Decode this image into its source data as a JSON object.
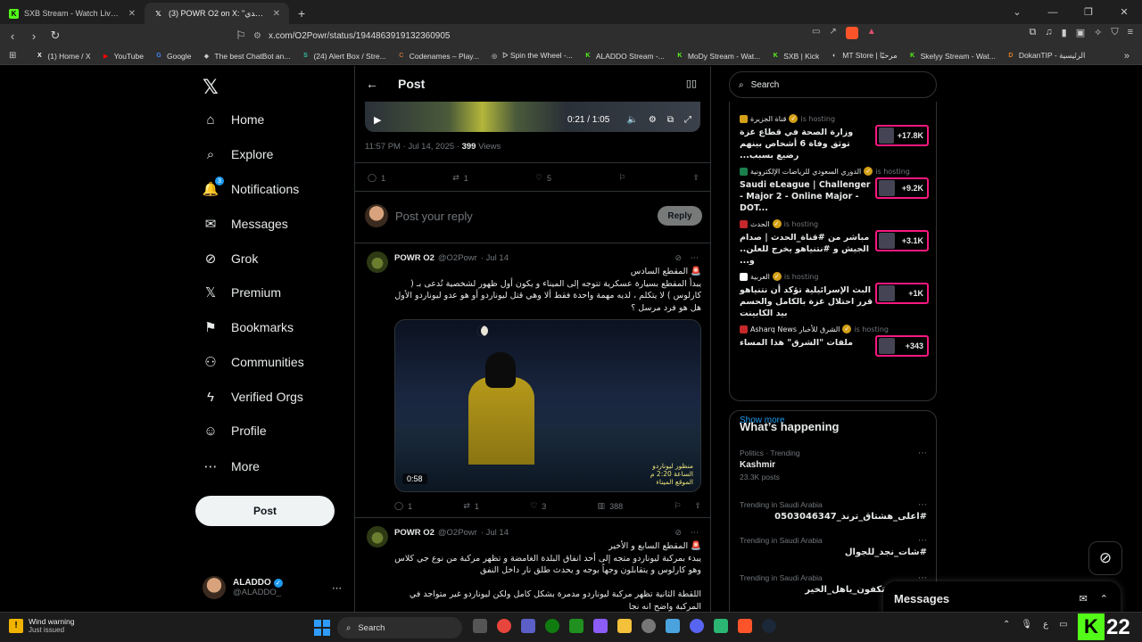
{
  "browser": {
    "tabs": [
      {
        "title": "SXB Stream - Watch Live on Kick",
        "icon": "kick-icon",
        "color": "#53fc18",
        "active": false
      },
      {
        "title": "(3) POWR O2 on X: \"لبوناردو كاسدي\"",
        "icon": "x-icon",
        "color": "#ffffff",
        "active": true
      }
    ],
    "new_tab": "+",
    "url": "x.com/O2Powr/status/1944863919132360905",
    "bookmarks": [
      {
        "label": "(1) Home / X",
        "color": "#ffffff",
        "glyph": "X"
      },
      {
        "label": "YouTube",
        "color": "#ff0000",
        "glyph": "▶"
      },
      {
        "label": "Google",
        "color": "#4285f4",
        "glyph": "G"
      },
      {
        "label": "The best ChatBot an...",
        "color": "#cccccc",
        "glyph": "◆"
      },
      {
        "label": "(24) Alert Box / Stre...",
        "color": "#31c3a2",
        "glyph": "S"
      },
      {
        "label": "Codenames – Play...",
        "color": "#c0703a",
        "glyph": "C"
      },
      {
        "label": "ᐅ Spin the Wheel -...",
        "color": "#e8e8e8",
        "glyph": "◎"
      },
      {
        "label": "ALADDO Stream -...",
        "color": "#53fc18",
        "glyph": "K"
      },
      {
        "label": "MoDy Stream - Wat...",
        "color": "#53fc18",
        "glyph": "K"
      },
      {
        "label": "SXB | Kick",
        "color": "#53fc18",
        "glyph": "K"
      },
      {
        "label": "MT Store | مرحبًا",
        "color": "#dddddd",
        "glyph": "◐"
      },
      {
        "label": "Skelyy Stream - Wat...",
        "color": "#53fc18",
        "glyph": "K"
      },
      {
        "label": "DokanTIP - الرئيسية",
        "color": "#d9822b",
        "glyph": "D"
      }
    ]
  },
  "nav": {
    "items": [
      {
        "label": "Home",
        "icon": "home-icon",
        "glyph": "⌂"
      },
      {
        "label": "Explore",
        "icon": "search-icon",
        "glyph": "⌕"
      },
      {
        "label": "Notifications",
        "icon": "bell-icon",
        "glyph": "🔔",
        "badge": "3"
      },
      {
        "label": "Messages",
        "icon": "mail-icon",
        "glyph": "✉"
      },
      {
        "label": "Grok",
        "icon": "grok-icon",
        "glyph": "⊘"
      },
      {
        "label": "Premium",
        "icon": "x-premium-icon",
        "glyph": "𝕏"
      },
      {
        "label": "Bookmarks",
        "icon": "bookmark-icon",
        "glyph": "⚑"
      },
      {
        "label": "Communities",
        "icon": "communities-icon",
        "glyph": "⚇"
      },
      {
        "label": "Verified Orgs",
        "icon": "lightning-icon",
        "glyph": "ϟ"
      },
      {
        "label": "Profile",
        "icon": "person-icon",
        "glyph": "☺"
      },
      {
        "label": "More",
        "icon": "more-circle-icon",
        "glyph": "⋯"
      }
    ],
    "post_label": "Post",
    "account": {
      "name": "ALADDO",
      "handle": "@ALADDO_"
    }
  },
  "main": {
    "title": "Post",
    "video_time": "0:21 / 1:05",
    "meta_time": "11:57 PM · Jul 14, 2025 · ",
    "meta_views_num": "399",
    "meta_views_label": " Views",
    "actions": {
      "replies": "1",
      "reposts": "1",
      "likes": "5"
    },
    "reply_placeholder": "Post your reply",
    "reply_button": "Reply",
    "tweets": [
      {
        "name": "POWR O2",
        "handle": "@O2Powr",
        "date": "· Jul 14",
        "lines": [
          "🚨 المقطع السادس",
          "يبدأ المقطع بسيارة عسكرية تتوجه إلى الميناء و يكون أول ظهور لشخصية تُدعى بـ (",
          "كارلوس ) لا يتكلم ، لديه مهمة واحدة فقط ألا وهي قتل ليوناردو أو هو عدو ليوناردو الأول",
          "هل هو فرد مرسل ؟"
        ],
        "media_time": "0:58",
        "media_caption": [
          "منظور ليوناردو",
          "الساعة 2:20 م",
          "الموقع الميناء"
        ],
        "stats": {
          "replies": "1",
          "reposts": "1",
          "likes": "3",
          "views": "388"
        }
      },
      {
        "name": "POWR O2",
        "handle": "@O2Powr",
        "date": "· Jul 14",
        "lines": [
          "🚨 المقطع السابع و الأخير",
          "يبدء بمركبة ليوناردو متجه إلى أحد انفاق البلدة الغامضة و تظهر مركبة من نوع جي كلاس",
          "وهو كارلوس و يتقابلون وجهاً بوجه و يحدث طلق نار داخل النفق",
          "",
          "اللقطة الثانية تظهر مركبة ليوناردو مدمرة بشكل كامل ولكن ليوناردو غير متواجد في",
          "المركبة واضح انه نجا"
        ]
      }
    ]
  },
  "right": {
    "search_placeholder": "Search",
    "live": [
      {
        "host": "قناة الجزيرة",
        "hosting": "is hosting",
        "title": "وزارة الصحة في قطاع غزة توثق وفاة 6 أشخاص بينهم رضيع بسبب...",
        "count": "+17.8K",
        "rtl": true,
        "dot": "#d4a017"
      },
      {
        "host": "الدوري السعودي للرياضات الإلكترونية",
        "hosting": "is hosting",
        "title": "Saudi eLeague | Challenger - Major 2 - Online Major - DOT...",
        "count": "+9.2K",
        "rtl": false,
        "dot": "#1a7f4b"
      },
      {
        "host": "الحدث",
        "hosting": "is hosting",
        "title": "مباشر من #قناة_الحدث | صدام الجيش و #نتنياهو يخرج للعلن.. و...",
        "count": "+3.1K",
        "rtl": true,
        "dot": "#c4282a"
      },
      {
        "host": "العربية",
        "hosting": "is hosting",
        "title": "البث الإسرائيلية تؤكد أن نتنياهو قرر احتلال غزة بالكامل والحسم بيد الكابينت",
        "count": "+1K",
        "rtl": true,
        "dot": "#ffffff"
      },
      {
        "host": "Asharq News الشرق للأخبار",
        "hosting": "is hosting",
        "title": "ملفات \"الشرق\" هذا المساء",
        "count": "+343",
        "rtl": true,
        "dot": "#c4282a"
      }
    ],
    "show_more": "Show more",
    "happening_title": "What’s happening",
    "trends": [
      {
        "cat": "Politics · Trending",
        "name": "Kashmir",
        "posts": "23.3K posts",
        "rtl": false
      },
      {
        "cat": "Trending in Saudi Arabia",
        "name": "#اعلى_هشتاق_ترند_0503046347",
        "posts": "",
        "rtl": true
      },
      {
        "cat": "Trending in Saudi Arabia",
        "name": "#شات_نجد_للجوال",
        "posts": "",
        "rtl": true
      },
      {
        "cat": "Trending in Saudi Arabia",
        "name": "#عمر52_تكفون_ياهل_الخير",
        "posts": "",
        "rtl": true
      }
    ]
  },
  "messages_dock": {
    "title": "Messages"
  },
  "taskbar": {
    "weather_title": "Wind warning",
    "weather_sub": "Just issued",
    "search": "Search",
    "kick_number": "22"
  }
}
